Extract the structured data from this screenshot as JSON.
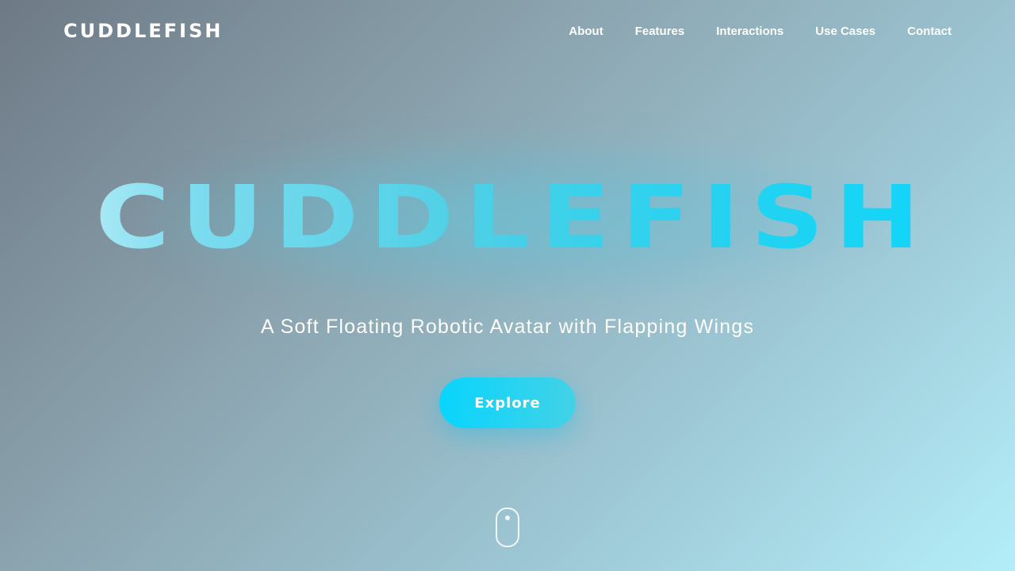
{
  "nav": {
    "logo": "CUDDLEFISH",
    "links": [
      "About",
      "Features",
      "Interactions",
      "Use Cases",
      "Contact"
    ]
  },
  "hero": {
    "title": "CUDDLEFISH",
    "subtitle": "A Soft Floating Robotic Avatar with Flapping Wings",
    "cta_label": "Explore"
  },
  "icons": {
    "scroll_indicator": "mouse-scroll-icon"
  },
  "colors": {
    "accent": "#0ad6fb",
    "accent_secondary": "#43d2e6",
    "title_gradient_start": "#d4f8fb",
    "title_gradient_end": "#0ad6fb",
    "background_start": "#6e7a86",
    "background_end": "#b3eef8",
    "text": "#ffffff"
  }
}
